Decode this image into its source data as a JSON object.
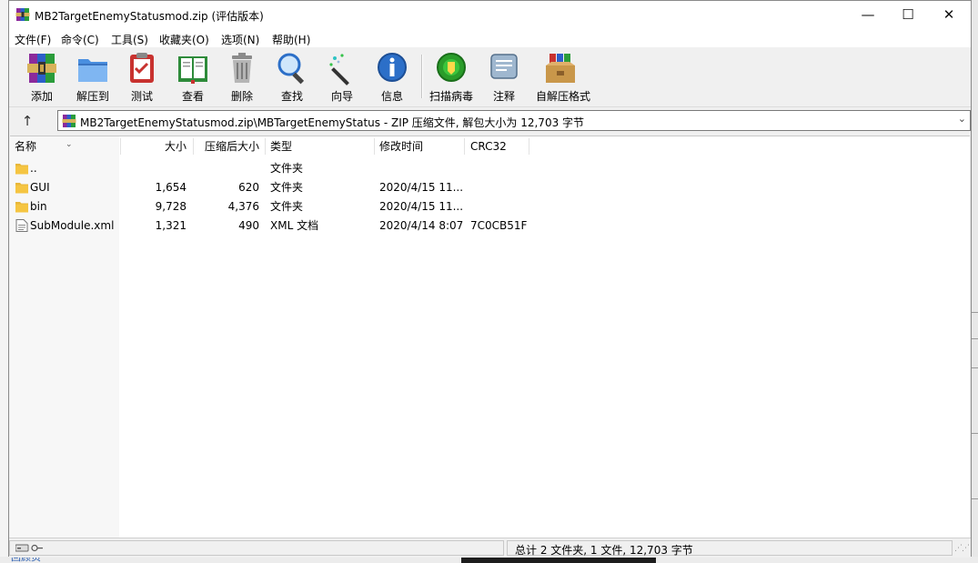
{
  "window": {
    "title": "MB2TargetEnemyStatusmod.zip (评估版本)",
    "controls": {
      "minimize": "—",
      "maximize": "☐",
      "close": "✕"
    }
  },
  "menu": [
    "文件(F)",
    "命令(C)",
    "工具(S)",
    "收藏夹(O)",
    "选项(N)",
    "帮助(H)"
  ],
  "toolbar": [
    {
      "label": "添加",
      "icon": "add-archive-icon"
    },
    {
      "label": "解压到",
      "icon": "extract-folder-icon"
    },
    {
      "label": "测试",
      "icon": "test-clipboard-icon"
    },
    {
      "label": "查看",
      "icon": "view-book-icon"
    },
    {
      "label": "删除",
      "icon": "trash-icon"
    },
    {
      "label": "查找",
      "icon": "magnifier-icon"
    },
    {
      "label": "向导",
      "icon": "wizard-wand-icon"
    },
    {
      "label": "信息",
      "icon": "info-icon"
    },
    {
      "label": "扫描病毒",
      "icon": "virus-scan-icon"
    },
    {
      "label": "注释",
      "icon": "comment-icon"
    },
    {
      "label": "自解压格式",
      "icon": "sfx-box-icon"
    }
  ],
  "address": {
    "up": "↑",
    "path": "MB2TargetEnemyStatusmod.zip\\MBTargetEnemyStatus - ZIP 压缩文件, 解包大小为 12,703 字节",
    "dropdown": "⌄"
  },
  "columns": {
    "name": "名称",
    "size": "大小",
    "packed": "压缩后大小",
    "type": "类型",
    "modified": "修改时间",
    "crc": "CRC32"
  },
  "files": [
    {
      "name": "..",
      "size": "",
      "packed": "",
      "type": "文件夹",
      "modified": "",
      "crc": "",
      "kind": "folder"
    },
    {
      "name": "GUI",
      "size": "1,654",
      "packed": "620",
      "type": "文件夹",
      "modified": "2020/4/15 11...",
      "crc": "",
      "kind": "folder"
    },
    {
      "name": "bin",
      "size": "9,728",
      "packed": "4,376",
      "type": "文件夹",
      "modified": "2020/4/15 11...",
      "crc": "",
      "kind": "folder"
    },
    {
      "name": "SubModule.xml",
      "size": "1,321",
      "packed": "490",
      "type": "XML 文档",
      "modified": "2020/4/14 8:07",
      "crc": "7C0CB51F",
      "kind": "file"
    }
  ],
  "status": {
    "summary": "总计 2 文件夹, 1 文件, 12,703 字节"
  },
  "background": {
    "bottom_left_text": "回顾页"
  },
  "colors": {
    "folder": "#f5c542",
    "accent_blue": "#1f6fd6",
    "green_scan": "#2a9c2a"
  }
}
